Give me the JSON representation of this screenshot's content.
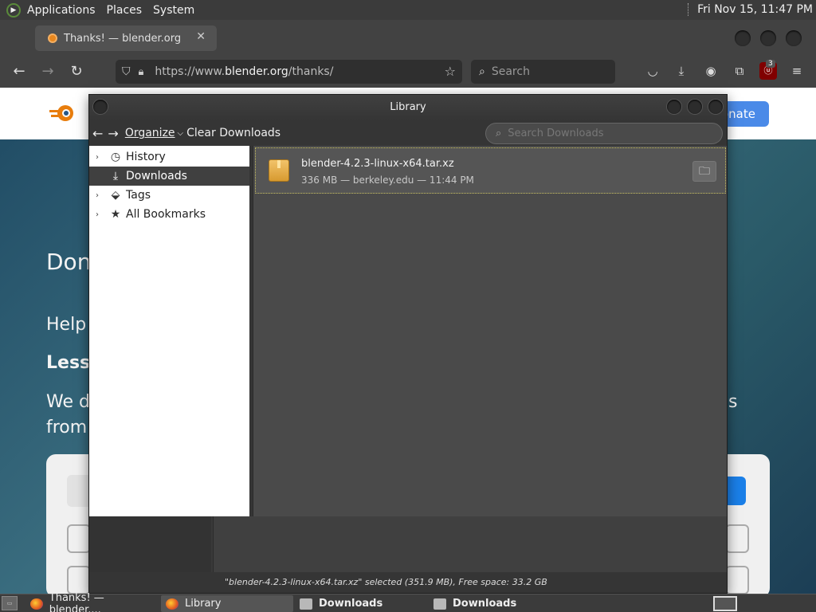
{
  "top_panel": {
    "menu": [
      "Applications",
      "Places",
      "System"
    ],
    "clock": "Fri Nov 15, 11:47 PM"
  },
  "browser": {
    "tab_title": "Thanks! — blender.org",
    "url_prefix": "https://www.",
    "url_domain": "blender.org",
    "url_path": "/thanks/",
    "search_placeholder": "Search",
    "ublock_count": "3"
  },
  "page": {
    "donate": "onate",
    "line1": "Don",
    "line2": "Help",
    "line3": "Less",
    "line4a": "We d",
    "line4b": "from",
    "line4c": "s"
  },
  "library": {
    "title": "Library",
    "toolbar": {
      "organize": "Organize",
      "clear": "Clear Downloads",
      "search_placeholder": "Search Downloads"
    },
    "sidebar": [
      {
        "label": "History",
        "icon": "clock-icon"
      },
      {
        "label": "Downloads",
        "icon": "download-icon"
      },
      {
        "label": "Tags",
        "icon": "tag-icon"
      },
      {
        "label": "All Bookmarks",
        "icon": "star-icon"
      }
    ],
    "download": {
      "filename": "blender-4.2.3-linux-x64.tar.xz",
      "meta": "336 MB — berkeley.edu — 11:44 PM"
    },
    "status": "\"blender-4.2.3-linux-x64.tar.xz\" selected (351.9 MB), Free space: 33.2 GB"
  },
  "taskbar": {
    "items": [
      "Thanks! — blender....",
      "Library",
      "Downloads",
      "Downloads"
    ]
  }
}
